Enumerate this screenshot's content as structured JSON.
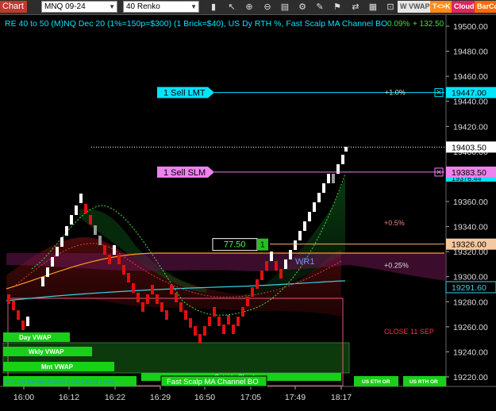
{
  "toolbar": {
    "chart_label": "Chart",
    "instrument": "MNQ 09-24",
    "bar_type": "40 Renko",
    "tags": {
      "w_vwap": "W VWAP",
      "t_k": "T<>K",
      "cloud": "Cloud",
      "barco": "BarCo"
    }
  },
  "chart": {
    "title": "RE 40 to 50 (M)NQ Dec 20 (1%=150p=$300) (1 Brick=$40), US Dy RTH %, Fast Scalp MA Channel BO",
    "top_right_text": "+ 132.50",
    "top_right_prefix": "0.09%",
    "price_ticks": [
      "19500.00",
      "19480.00",
      "19460.00",
      "19440.00",
      "19420.00",
      "19400.00",
      "19380.00",
      "19360.00",
      "19340.00",
      "19320.00",
      "19300.00",
      "19280.00",
      "19260.00",
      "19240.00",
      "19220.00"
    ],
    "price_tick_values": [
      19500,
      19480,
      19460,
      19440,
      19420,
      19400,
      19380,
      19360,
      19340,
      19320,
      19300,
      19280,
      19260,
      19240,
      19220
    ],
    "time_ticks": [
      "16:00",
      "16:12",
      "16:22",
      "16:29",
      "16:50",
      "17:05",
      "17:49",
      "18:17"
    ],
    "price_min": 19210,
    "price_max": 19510,
    "markers": {
      "sell_lmt": {
        "label": "1 Sell LMT",
        "price": 19447.0,
        "price_label": "19447.00",
        "pct": "+1.0%",
        "color": "#00e5ff"
      },
      "sell_slm": {
        "label": "1 Sell SLM",
        "price": 19383.5,
        "price_label": "19383.50",
        "color": "#ee82ee"
      },
      "last": {
        "price": 19403.5,
        "price_label": "19403.50"
      },
      "cloud_low": {
        "price": 19291.6,
        "price_label": "19291.60"
      },
      "orange": {
        "price": 19326.0,
        "price_label": "19326.00"
      },
      "partial_top": "19376.44"
    },
    "position": {
      "value": "77.50",
      "qty": "1"
    },
    "labels": {
      "pct_05": "+0.5%",
      "pct_025": "+0.25%",
      "close": "CLOSE 11 SEP",
      "wr1": "WR1"
    },
    "vwap_bars": [
      {
        "label": "Day VWAP"
      },
      {
        "label": "Wkly VWAP"
      },
      {
        "label": "Mnt VWAP"
      }
    ],
    "bottom_buttons": {
      "outside_clouds": "Outside Clouds",
      "fast_scalp": "Fast Scalp MA Channel BO",
      "copyright": "© 2024 Renko-Kaiser Fast Cloud Lines",
      "us_eth": "US ETH OR",
      "us_rth": "US RTH OR"
    }
  },
  "chart_data": {
    "type": "candlestick",
    "y_range": [
      19210,
      19510
    ],
    "bricks": [
      {
        "o": 19300,
        "c": 19280,
        "dir": "down"
      },
      {
        "o": 19280,
        "c": 19260,
        "dir": "down"
      },
      {
        "o": 19270,
        "c": 19290,
        "dir": "up"
      },
      {
        "o": 19290,
        "c": 19310,
        "dir": "up"
      },
      {
        "o": 19310,
        "c": 19330,
        "dir": "up"
      },
      {
        "o": 19330,
        "c": 19350,
        "dir": "up"
      },
      {
        "o": 19350,
        "c": 19370,
        "dir": "up"
      },
      {
        "o": 19370,
        "c": 19390,
        "dir": "up"
      },
      {
        "o": 19380,
        "c": 19360,
        "dir": "down"
      },
      {
        "o": 19360,
        "c": 19340,
        "dir": "down"
      },
      {
        "o": 19340,
        "c": 19320,
        "dir": "down"
      },
      {
        "o": 19320,
        "c": 19300,
        "dir": "down"
      },
      {
        "o": 19300,
        "c": 19280,
        "dir": "down"
      },
      {
        "o": 19280,
        "c": 19260,
        "dir": "down"
      },
      {
        "o": 19260,
        "c": 19250,
        "dir": "down"
      },
      {
        "o": 19255,
        "c": 19275,
        "dir": "up"
      },
      {
        "o": 19275,
        "c": 19295,
        "dir": "up"
      },
      {
        "o": 19295,
        "c": 19315,
        "dir": "up"
      },
      {
        "o": 19315,
        "c": 19335,
        "dir": "up"
      },
      {
        "o": 19335,
        "c": 19355,
        "dir": "up"
      },
      {
        "o": 19355,
        "c": 19375,
        "dir": "up"
      },
      {
        "o": 19375,
        "c": 19395,
        "dir": "up"
      },
      {
        "o": 19395,
        "c": 19405,
        "dir": "up"
      }
    ]
  }
}
